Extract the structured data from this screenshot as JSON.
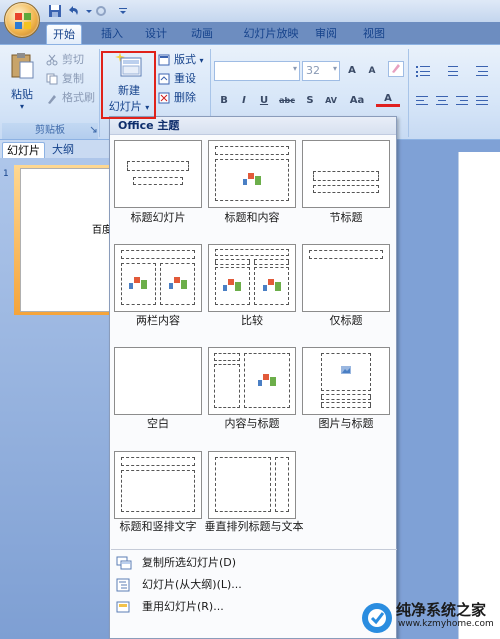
{
  "qat": {
    "icons": [
      "save-icon",
      "undo-icon",
      "redo-icon",
      "customize-qat-icon"
    ]
  },
  "tabs": [
    {
      "label": "开始",
      "active": true
    },
    {
      "label": "插入"
    },
    {
      "label": "设计"
    },
    {
      "label": "动画"
    },
    {
      "label": "幻灯片放映"
    },
    {
      "label": "审阅"
    },
    {
      "label": "视图"
    }
  ],
  "clipboard": {
    "paste": "粘贴",
    "cut": "剪切",
    "copy": "复制",
    "format_painter": "格式刷",
    "group_title": "剪贴板"
  },
  "slides": {
    "new_slide_line1": "新建",
    "new_slide_line2": "幻灯片",
    "layout": "版式",
    "reset": "重设",
    "delete": "删除"
  },
  "font": {
    "size_value": "32",
    "grow": "A",
    "shrink": "A",
    "bold": "B",
    "italic": "I",
    "underline": "U",
    "strikethrough": "abc",
    "shadow": "S",
    "spacing": "AV",
    "case": "Aa",
    "color": "A"
  },
  "pane": {
    "tab_slides": "幻灯片",
    "tab_outline": "大纲",
    "slide_number": "1",
    "slide_text": "百度"
  },
  "dropdown": {
    "header": "Office 主题",
    "layouts": [
      {
        "label": "标题幻灯片"
      },
      {
        "label": "标题和内容"
      },
      {
        "label": "节标题"
      },
      {
        "label": "两栏内容"
      },
      {
        "label": "比较"
      },
      {
        "label": "仅标题"
      },
      {
        "label": "空白"
      },
      {
        "label": "内容与标题"
      },
      {
        "label": "图片与标题"
      },
      {
        "label": "标题和竖排文字"
      },
      {
        "label": "垂直排列标题与文本"
      }
    ],
    "commands": [
      {
        "label": "复制所选幻灯片(D)"
      },
      {
        "label": "幻灯片(从大纲)(L)..."
      },
      {
        "label": "重用幻灯片(R)..."
      }
    ]
  },
  "watermark": {
    "title": "纯净系统之家",
    "url": "www.kzmyhome.com"
  },
  "colors": {
    "ribbon_blue": "#15428b",
    "highlight_red": "#e0221a",
    "selection_orange": "#f5a43a"
  }
}
